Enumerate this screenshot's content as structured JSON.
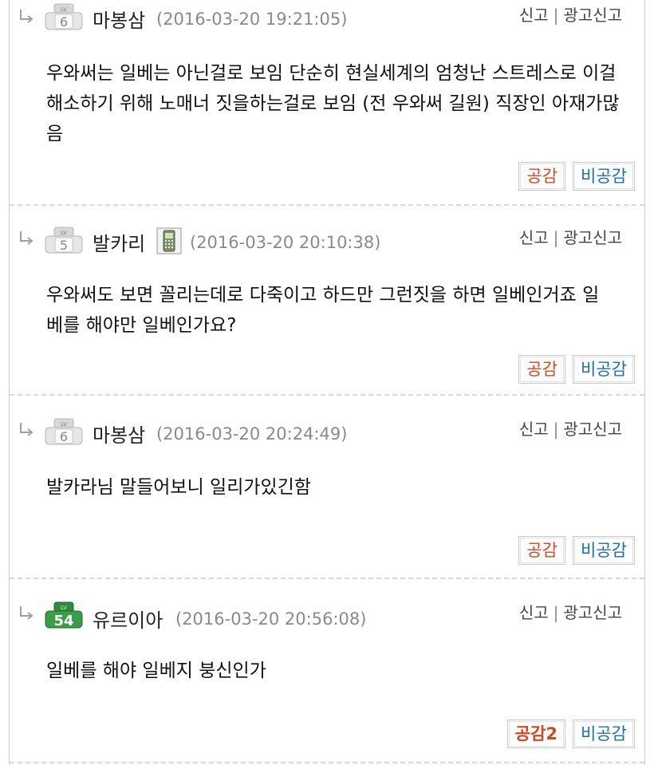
{
  "colors": {
    "like": "#d2471f",
    "dislike": "#1b6fb5",
    "date": "#8a8a8a"
  },
  "comments": [
    {
      "nickname": "마봉삼",
      "level": "6",
      "date": "(2016-03-20 19:21:05)",
      "report_label": "신고",
      "ad_report_label": "광고신고",
      "text": "우와써는 일베는 아닌걸로 보임 단순히 현실세계의 엄청난 스트레스로 이걸 해소하기 위해 노매너 짓을하는걸로 보임 (전 우와써 길원) 직장인 아재가많음",
      "like_label": "공감",
      "dislike_label": "비공감"
    },
    {
      "nickname": "발카리",
      "level": "5",
      "date": "(2016-03-20 20:10:38)",
      "device_icon": "mobile-phone-icon",
      "report_label": "신고",
      "ad_report_label": "광고신고",
      "text": "우와써도 보면 꼴리는데로 다죽이고 하드만  그런짓을 하면 일베인거죠 일베를 해야만 일베인가요?",
      "like_label": "공감",
      "dislike_label": "비공감"
    },
    {
      "nickname": "마봉삼",
      "level": "6",
      "date": "(2016-03-20 20:24:49)",
      "report_label": "신고",
      "ad_report_label": "광고신고",
      "text": "발카라님 말들어보니 일리가있긴함",
      "like_label": "공감",
      "dislike_label": "비공감"
    },
    {
      "nickname": "유르이아",
      "level": "54",
      "date": "(2016-03-20 20:56:08)",
      "report_label": "신고",
      "ad_report_label": "광고신고",
      "text": "일베를 해야 일베지 붕신인가",
      "like_label": "공감2",
      "dislike_label": "비공감"
    }
  ]
}
